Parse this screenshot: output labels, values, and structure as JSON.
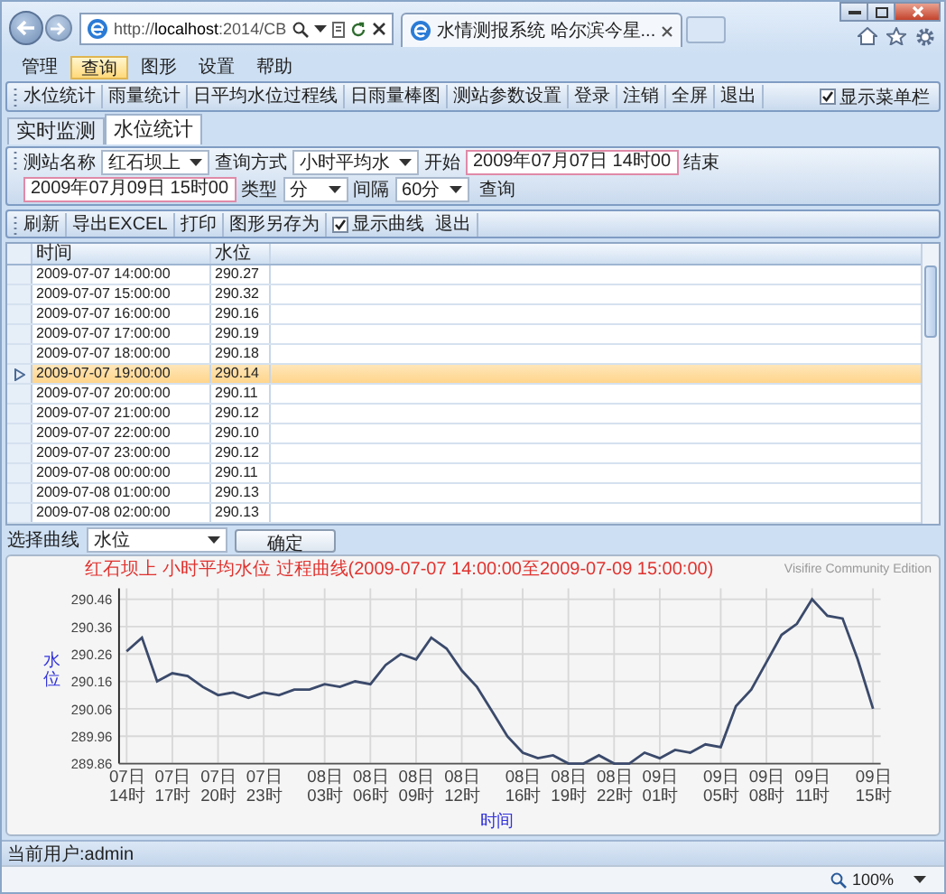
{
  "browser": {
    "address": "http://**localhost**:2014/CB",
    "tab_title": "水情测报系统 哈尔滨今星...",
    "zoom": "100%"
  },
  "menu": [
    {
      "label": "管理",
      "selected": false
    },
    {
      "label": "查询",
      "selected": true
    },
    {
      "label": "图形",
      "selected": false
    },
    {
      "label": "设置",
      "selected": false
    },
    {
      "label": "帮助",
      "selected": false
    }
  ],
  "toolbar": {
    "items": [
      "水位统计",
      "雨量统计",
      "日平均水位过程线",
      "日雨量棒图",
      "测站参数设置",
      "登录",
      "注销",
      "全屏",
      "退出"
    ],
    "checkbox": {
      "label": "显示菜单栏",
      "checked": true
    }
  },
  "tabs": [
    {
      "label": "实时监测",
      "selected": false
    },
    {
      "label": "水位统计",
      "selected": true
    }
  ],
  "query_bar": [
    {
      "kind": "label",
      "text": "测站名称"
    },
    {
      "kind": "combo",
      "value": "红石坝上"
    },
    {
      "kind": "label",
      "text": "查询方式"
    },
    {
      "kind": "combo",
      "value": "小时平均水"
    },
    {
      "kind": "label",
      "text": "开始"
    },
    {
      "kind": "date",
      "value": "2009年07月07日 14时00"
    },
    {
      "kind": "label",
      "text": "结束"
    },
    {
      "kind": "date",
      "value": "2009年07月09日 15时00"
    },
    {
      "kind": "label",
      "text": "类型"
    },
    {
      "kind": "combo",
      "value": "分"
    },
    {
      "kind": "label",
      "text": "间隔"
    },
    {
      "kind": "combo",
      "value": "60分"
    },
    {
      "kind": "button",
      "text": "查询"
    }
  ],
  "actions": [
    {
      "kind": "button",
      "text": "刷新"
    },
    {
      "kind": "button",
      "text": "导出EXCEL"
    },
    {
      "kind": "button",
      "text": "打印"
    },
    {
      "kind": "button",
      "text": "图形另存为"
    },
    {
      "kind": "checkbox",
      "text": "显示曲线",
      "checked": true
    },
    {
      "kind": "button",
      "text": "退出"
    }
  ],
  "table": {
    "columns": [
      "时间",
      "水位"
    ],
    "rows": [
      {
        "cells": [
          "2009-07-07 14:00:00",
          "290.27"
        ],
        "selected": false
      },
      {
        "cells": [
          "2009-07-07 15:00:00",
          "290.32"
        ],
        "selected": false
      },
      {
        "cells": [
          "2009-07-07 16:00:00",
          "290.16"
        ],
        "selected": false
      },
      {
        "cells": [
          "2009-07-07 17:00:00",
          "290.19"
        ],
        "selected": false
      },
      {
        "cells": [
          "2009-07-07 18:00:00",
          "290.18"
        ],
        "selected": false
      },
      {
        "cells": [
          "2009-07-07 19:00:00",
          "290.14"
        ],
        "selected": true
      },
      {
        "cells": [
          "2009-07-07 20:00:00",
          "290.11"
        ],
        "selected": false
      },
      {
        "cells": [
          "2009-07-07 21:00:00",
          "290.12"
        ],
        "selected": false
      },
      {
        "cells": [
          "2009-07-07 22:00:00",
          "290.10"
        ],
        "selected": false
      },
      {
        "cells": [
          "2009-07-07 23:00:00",
          "290.12"
        ],
        "selected": false
      },
      {
        "cells": [
          "2009-07-08 00:00:00",
          "290.11"
        ],
        "selected": false
      },
      {
        "cells": [
          "2009-07-08 01:00:00",
          "290.13"
        ],
        "selected": false
      },
      {
        "cells": [
          "2009-07-08 02:00:00",
          "290.13"
        ],
        "selected": false
      }
    ]
  },
  "curve_picker": {
    "label": "选择曲线",
    "value": "水位",
    "button": "确定"
  },
  "chart": {
    "watermark": "Visifire Community Edition",
    "chart_data": {
      "type": "line",
      "title": "红石坝上 小时平均水位 过程曲线(2009-07-07 14:00:00至2009-07-09 15:00:00)",
      "xlabel": "时间",
      "ylabel": "水位",
      "categories": [
        "07日14时",
        null,
        null,
        "07日17时",
        null,
        null,
        "07日20时",
        null,
        null,
        "07日23时",
        null,
        null,
        null,
        "08日03时",
        null,
        null,
        "08日06时",
        null,
        null,
        "08日09时",
        null,
        null,
        "08日12时",
        null,
        null,
        null,
        "08日16时",
        null,
        null,
        "08日19时",
        null,
        null,
        "08日22时",
        null,
        null,
        "09日01时",
        null,
        null,
        null,
        "09日05时",
        null,
        null,
        "09日08时",
        null,
        null,
        "09日11时",
        null,
        null,
        null,
        "09日15时"
      ],
      "series": [
        {
          "color": "#3b4a6b",
          "values": [
            290.27,
            290.32,
            290.16,
            290.19,
            290.18,
            290.14,
            290.11,
            290.12,
            290.1,
            290.12,
            290.11,
            290.13,
            290.13,
            290.15,
            290.14,
            290.16,
            290.15,
            290.22,
            290.26,
            290.24,
            290.32,
            290.28,
            290.2,
            290.14,
            290.05,
            289.96,
            289.9,
            289.88,
            289.89,
            289.86,
            289.86,
            289.89,
            289.86,
            289.86,
            289.9,
            289.88,
            289.91,
            289.9,
            289.93,
            289.92,
            290.07,
            290.13,
            290.23,
            290.33,
            290.37,
            290.46,
            290.4,
            290.39,
            290.24,
            290.06
          ]
        }
      ],
      "ylim": [
        289.86,
        290.5
      ],
      "grid": true,
      "yticks": [
        {
          "value": 289.86,
          "label": "289.86"
        },
        {
          "value": 289.96,
          "label": "289.96"
        },
        {
          "value": 290.06,
          "label": "290.06"
        },
        {
          "value": 290.16,
          "label": "290.16"
        },
        {
          "value": 290.26,
          "label": "290.26"
        },
        {
          "value": 290.36,
          "label": "290.36"
        },
        {
          "value": 290.46,
          "label": "290.46"
        }
      ]
    }
  },
  "status": "当前用户:admin"
}
